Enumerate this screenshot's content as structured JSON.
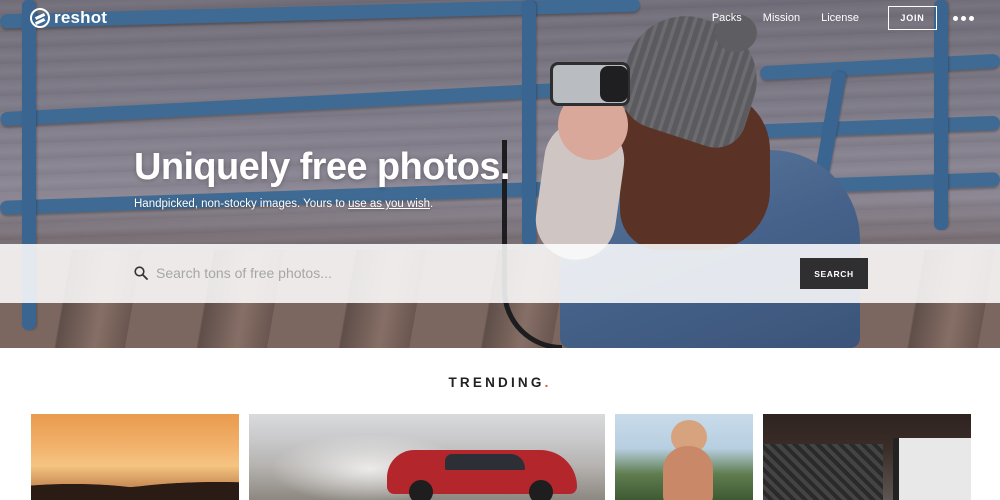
{
  "brand": {
    "name": "reshot"
  },
  "nav": {
    "links": [
      "Packs",
      "Mission",
      "License"
    ],
    "join_label": "JOIN"
  },
  "hero": {
    "headline": "Uniquely free photos.",
    "subline_prefix": "Handpicked, non-stocky images. Yours to ",
    "subline_link": "use as you wish",
    "subline_suffix": "."
  },
  "search": {
    "placeholder": "Search tons of free photos...",
    "value": "",
    "button_label": "SEARCH"
  },
  "trending": {
    "title": "TRENDING",
    "accent_dot": ".",
    "accent_color": "#e4572e"
  },
  "icons": {
    "logo": "reshot-logo-icon",
    "search": "search-icon",
    "more": "more-dots-icon"
  }
}
